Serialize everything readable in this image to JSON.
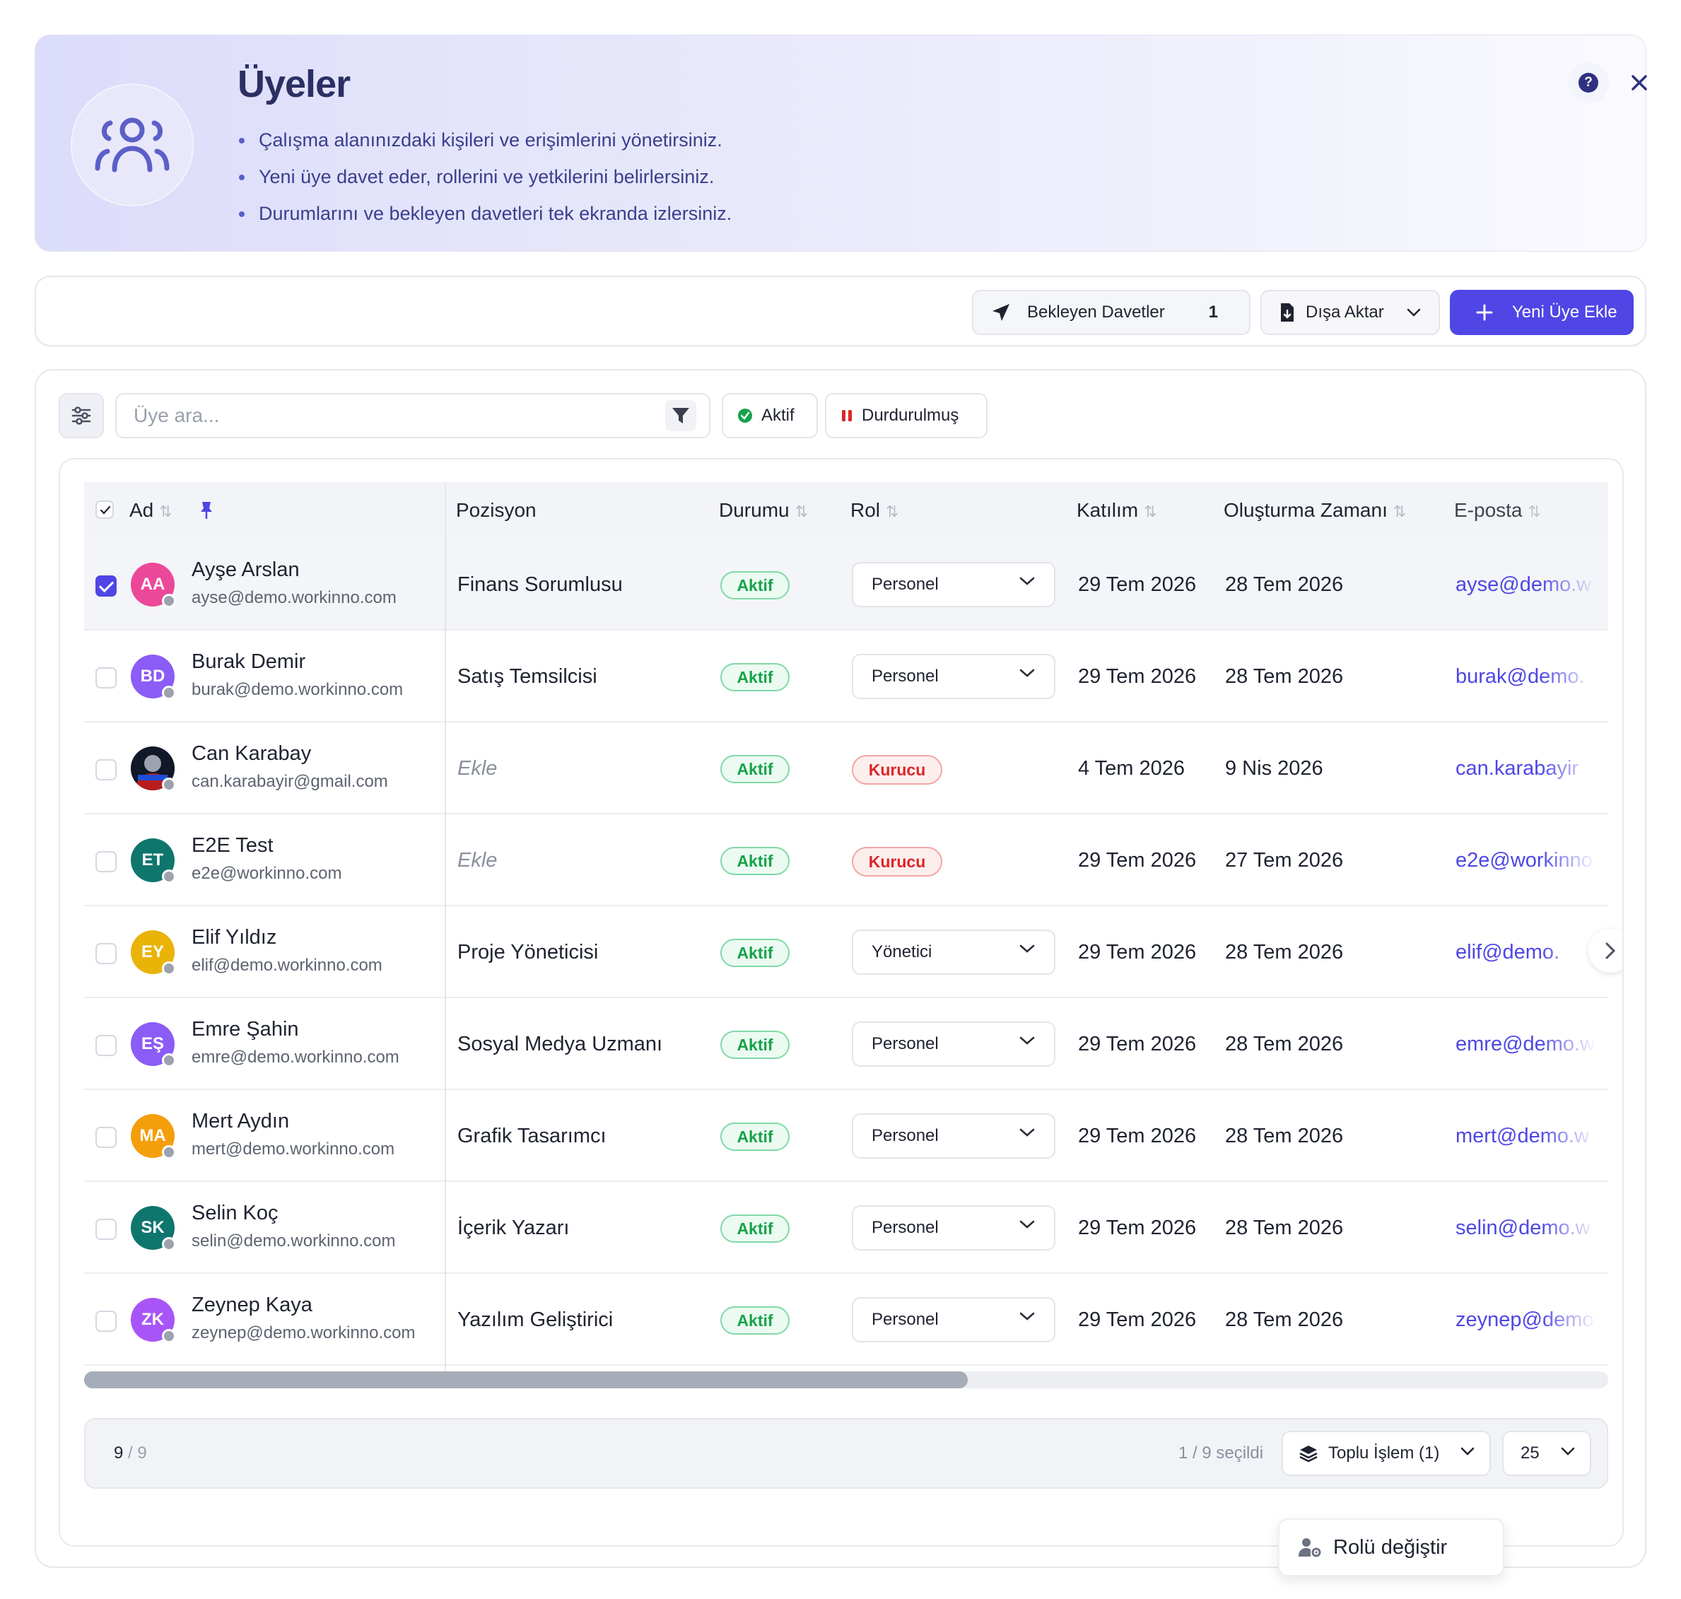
{
  "header": {
    "title": "Üyeler",
    "bullets": [
      "Çalışma alanınızdaki kişileri ve erişimlerini yönetirsiniz.",
      "Yeni üye davet eder, rollerini ve yetkilerini belirlersiniz.",
      "Durumlarını ve bekleyen davetleri tek ekranda izlersiniz."
    ],
    "icon": "users-icon",
    "help_icon": "help-circle-icon",
    "close_icon": "close-icon"
  },
  "toolbar": {
    "pending_label": "Bekleyen Davetler",
    "pending_count": "1",
    "export_label": "Dışa Aktar",
    "add_label": "Yeni Üye Ekle"
  },
  "filters": {
    "search_placeholder": "Üye ara...",
    "chip_active": "Aktif",
    "chip_paused": "Durdurulmuş"
  },
  "table": {
    "columns": {
      "name": "Ad",
      "position": "Pozisyon",
      "status": "Durumu",
      "role": "Rol",
      "joined": "Katılım",
      "created": "Oluşturma Zamanı",
      "email": "E-posta"
    },
    "rows": [
      {
        "initials": "AA",
        "name": "Ayşe Arslan",
        "email": "ayse@demo.workinno.com",
        "position": "Finans Sorumlusu",
        "status": "Aktif",
        "role": "Personel",
        "joined": "29 Tem 2026",
        "created": "28 Tem 2026",
        "email_short": "ayse@demo.w",
        "color": "#ec4899",
        "selected": true
      },
      {
        "initials": "BD",
        "name": "Burak Demir",
        "email": "burak@demo.workinno.com",
        "position": "Satış Temsilcisi",
        "status": "Aktif",
        "role": "Personel",
        "joined": "29 Tem 2026",
        "created": "28 Tem 2026",
        "email_short": "burak@demo.",
        "color": "#8b5cf6"
      },
      {
        "initials": "",
        "name": "Can Karabay",
        "email": "can.karabayir@gmail.com",
        "position": "Ekle",
        "status": "Aktif",
        "role": "Kurucu",
        "joined": "4 Tem 2026",
        "created": "9 Nis 2026",
        "email_short": "can.karabayir",
        "color": "#1f2937",
        "photo": true
      },
      {
        "initials": "ET",
        "name": "E2E Test",
        "email": "e2e@workinno.com",
        "position": "Ekle",
        "status": "Aktif",
        "role": "Kurucu",
        "joined": "29 Tem 2026",
        "created": "27 Tem 2026",
        "email_short": "e2e@workinno",
        "color": "#0f766e"
      },
      {
        "initials": "EY",
        "name": "Elif Yıldız",
        "email": "elif@demo.workinno.com",
        "position": "Proje Yöneticisi",
        "status": "Aktif",
        "role": "Yönetici",
        "joined": "29 Tem 2026",
        "created": "28 Tem 2026",
        "email_short": "elif@demo.",
        "color": "#eab308"
      },
      {
        "initials": "EŞ",
        "name": "Emre Şahin",
        "email": "emre@demo.workinno.com",
        "position": "Sosyal Medya Uzmanı",
        "status": "Aktif",
        "role": "Personel",
        "joined": "29 Tem 2026",
        "created": "28 Tem 2026",
        "email_short": "emre@demo.w",
        "color": "#8b5cf6"
      },
      {
        "initials": "MA",
        "name": "Mert Aydın",
        "email": "mert@demo.workinno.com",
        "position": "Grafik Tasarımcı",
        "status": "Aktif",
        "role": "Personel",
        "joined": "29 Tem 2026",
        "created": "28 Tem 2026",
        "email_short": "mert@demo.w",
        "color": "#f59e0b"
      },
      {
        "initials": "SK",
        "name": "Selin Koç",
        "email": "selin@demo.workinno.com",
        "position": "İçerik Yazarı",
        "status": "Aktif",
        "role": "Personel",
        "joined": "29 Tem 2026",
        "created": "28 Tem 2026",
        "email_short": "selin@demo.w",
        "color": "#0f766e"
      },
      {
        "initials": "ZK",
        "name": "Zeynep Kaya",
        "email": "zeynep@demo.workinno.com",
        "position": "Yazılım Geliştirici",
        "status": "Aktif",
        "role": "Personel",
        "joined": "29 Tem 2026",
        "created": "28 Tem 2026",
        "email_short": "zeynep@demo",
        "color": "#a855f7"
      }
    ],
    "horizontal_scroll_fraction": 0.58
  },
  "footer": {
    "shown": "9",
    "separator": "/",
    "total": "9",
    "selected_info": "1 / 9 seçildi",
    "bulk_label": "Toplu İşlem (1)",
    "per_page": "25"
  },
  "bulk_menu": {
    "items": [
      "Rolü değiştir"
    ]
  },
  "colors": {
    "accent": "#4f46e5",
    "active_green": "#16a34a",
    "founder_red": "#dc2626"
  }
}
